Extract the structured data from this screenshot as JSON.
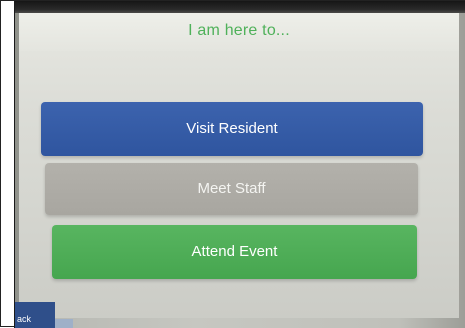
{
  "screen": {
    "title": "I am here to...",
    "options": [
      {
        "label": "Visit Resident",
        "color": "#3359a6"
      },
      {
        "label": "Meet Staff",
        "color": "#adaba5"
      },
      {
        "label": "Attend Event",
        "color": "#4dad56"
      }
    ],
    "back_label": "ack"
  },
  "colors": {
    "title_green": "#4fb15a"
  }
}
